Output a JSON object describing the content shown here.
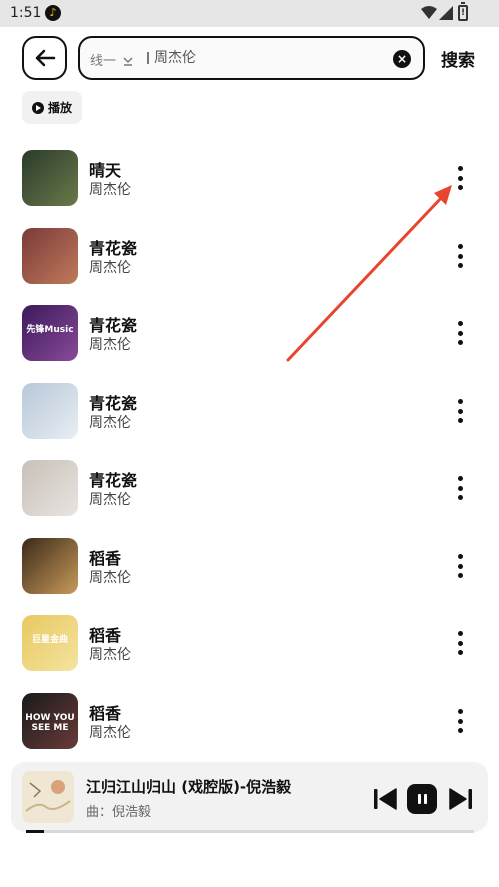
{
  "status_bar": {
    "time": "1:51",
    "notif_glyph": "♪",
    "battery_glyph": "!"
  },
  "header": {
    "line_selector": "线一",
    "search_query": "周杰伦",
    "search_button": "搜索"
  },
  "play_all_label": "播放",
  "songs": [
    {
      "title": "晴天",
      "artist": "周杰伦",
      "cover_colors": [
        "#2b3a2a",
        "#6a7a4a"
      ]
    },
    {
      "title": "青花瓷",
      "artist": "周杰伦",
      "cover_colors": [
        "#7a3a3a",
        "#c07a5a"
      ]
    },
    {
      "title": "青花瓷",
      "artist": "周杰伦",
      "cover_colors": [
        "#3a1a5a",
        "#8a4a9a"
      ],
      "cover_text": "先锋Music"
    },
    {
      "title": "青花瓷",
      "artist": "周杰伦",
      "cover_colors": [
        "#b8c8d8",
        "#e8eef4"
      ]
    },
    {
      "title": "青花瓷",
      "artist": "周杰伦",
      "cover_colors": [
        "#c8c0b8",
        "#e8e4e0"
      ]
    },
    {
      "title": "稻香",
      "artist": "周杰伦",
      "cover_colors": [
        "#3a2a1a",
        "#c89a5a"
      ]
    },
    {
      "title": "稻香",
      "artist": "周杰伦",
      "cover_colors": [
        "#e8c860",
        "#f4e4a0"
      ],
      "cover_text": "巨星金曲"
    },
    {
      "title": "稻香",
      "artist": "周杰伦",
      "cover_colors": [
        "#1a1a1a",
        "#6a3a3a"
      ],
      "cover_text": "HOW YOU SEE ME"
    }
  ],
  "now_playing": {
    "title": "江归江山归山 (戏腔版)-倪浩毅",
    "subtitle": "曲：倪浩毅",
    "progress_fraction": 0.04
  },
  "colors": {
    "annotation_arrow": "#e8452f"
  }
}
